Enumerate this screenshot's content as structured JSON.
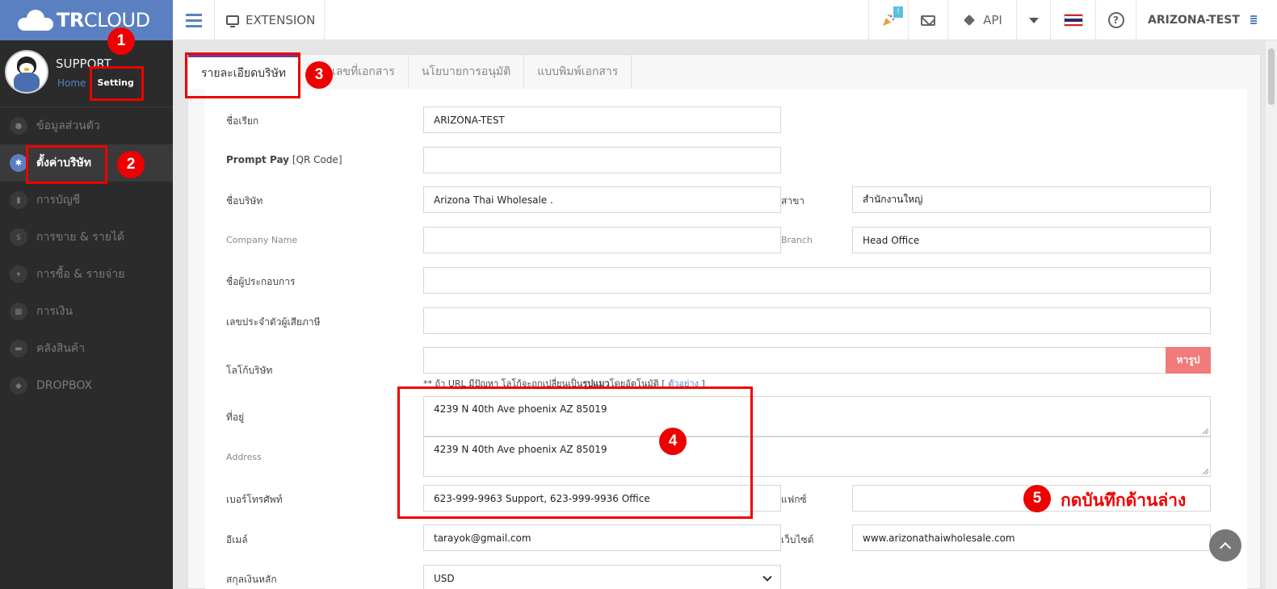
{
  "header": {
    "logo_bold": "TR",
    "logo_rest": "CLOUD",
    "extension_label": "EXTENSION",
    "notification_badge": "!",
    "api_label": "API",
    "account_label": "ARIZONA-TEST"
  },
  "sidebar": {
    "profile_name": "SUPPORT",
    "home_link": "Home",
    "setting_link": "Setting",
    "items": [
      {
        "label": "ข้อมูลส่วนตัว",
        "icon": "user-icon"
      },
      {
        "label": "ตั้งค่าบริษัท",
        "icon": "gear-icon"
      },
      {
        "label": "การบัญชี",
        "icon": "book-icon"
      },
      {
        "label": "การขาย & รายได้",
        "icon": "dollar-icon"
      },
      {
        "label": "การซื้อ & รายจ่าย",
        "icon": "cart-icon"
      },
      {
        "label": "การเงิน",
        "icon": "calendar-icon"
      },
      {
        "label": "คลังสินค้า",
        "icon": "truck-icon"
      },
      {
        "label": "DROPBOX",
        "icon": "dropbox-icon"
      }
    ]
  },
  "tabs": [
    {
      "label": "รายละเอียดบริษัท"
    },
    {
      "label": "เลขที่เอกสาร"
    },
    {
      "label": "นโยบายการอนุมัติ"
    },
    {
      "label": "แบบพิมพ์เอกสาร"
    }
  ],
  "form": {
    "nickname_label": "ชื่อเรียก",
    "nickname_value": "ARIZONA-TEST",
    "promptpay_label_bold": "Prompt Pay",
    "promptpay_label_rest": " [QR Code]",
    "promptpay_value": "",
    "company_name_th_label": "ชื่อบริษัท",
    "company_name_th_value": "Arizona Thai Wholesale .",
    "branch_th_label": "สาขา",
    "branch_th_value": "สำนักงานใหญ่",
    "company_name_en_label": "Company Name",
    "company_name_en_value": "",
    "branch_en_label": "Branch",
    "branch_en_value": "Head Office",
    "operator_label": "ชื่อผู้ประกอบการ",
    "operator_value": "",
    "taxid_label": "เลขประจำตัวผู้เสียภาษี",
    "taxid_value": "",
    "logo_label": "โลโก้บริษัท",
    "logo_value": "",
    "logo_button": "หารูป",
    "logo_hint_a": "** ถ้า URL มีปัญหา โลโก้จะถูกเปลี่ยนเป็น",
    "logo_hint_b": "รูปแมว",
    "logo_hint_c": "โดยอัตโนมัติ  [ ",
    "logo_hint_link": "ตัวอย่าง",
    "logo_hint_d": " ]",
    "address_th_label": "ที่อยู่",
    "address_th_value": "4239 N 40th Ave phoenix AZ 85019",
    "address_en_label": "Address",
    "address_en_value": "4239 N 40th Ave phoenix AZ 85019",
    "phone_label": "เบอร์โทรศัพท์",
    "phone_value": "623-999-9963 Support, 623-999-9936 Office",
    "fax_label": "แฟกซ์",
    "fax_value": "",
    "email_label": "อีเมล์",
    "email_value": "tarayok@gmail.com",
    "website_label": "เว็บไซต์",
    "website_value": "www.arizonathaiwholesale.com",
    "currency_label": "สกุลเงินหลัก",
    "currency_value": "USD"
  },
  "annotations": {
    "n1": "1",
    "n2": "2",
    "n3": "3",
    "n4": "4",
    "n5": "5",
    "note5": "กดบันทึกด้านล่าง",
    "color": "#e00000"
  },
  "colors": {
    "brand": "#5b80c2",
    "sidebar_bg": "#2b2b2b",
    "active_tab_border": "#6a3d8f",
    "image_button": "#f17a7a"
  }
}
